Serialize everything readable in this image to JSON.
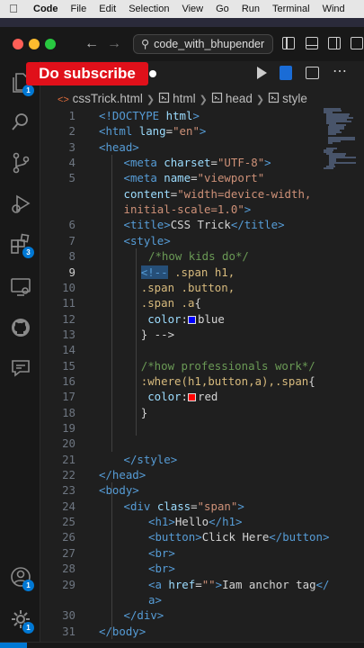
{
  "menubar": {
    "apple": "",
    "app_name": "Code",
    "items": [
      "File",
      "Edit",
      "Selection",
      "View",
      "Go",
      "Run",
      "Terminal",
      "Wind"
    ]
  },
  "titlebar": {
    "search_text": "code_with_bhupender",
    "back_icon": "arrow-left-icon",
    "forward_icon": "arrow-right-icon",
    "search_icon": "search-icon"
  },
  "overlay": {
    "subscribe_text": "Do subscribe"
  },
  "activity_bar": {
    "items": [
      {
        "name": "explorer",
        "icon": "files-icon",
        "badge": "1"
      },
      {
        "name": "search",
        "icon": "search-icon"
      },
      {
        "name": "source-control",
        "icon": "source-control-icon"
      },
      {
        "name": "run-debug",
        "icon": "run-debug-icon"
      },
      {
        "name": "extensions",
        "icon": "extensions-icon",
        "badge": "3"
      },
      {
        "name": "remote-explorer",
        "icon": "remote-explorer-icon"
      },
      {
        "name": "github",
        "icon": "github-icon"
      },
      {
        "name": "chat",
        "icon": "chat-icon"
      }
    ],
    "bottom": [
      {
        "name": "accounts",
        "icon": "account-icon",
        "badge": "1"
      },
      {
        "name": "manage",
        "icon": "gear-icon",
        "badge": "1"
      }
    ]
  },
  "breadcrumb": {
    "file": "cssTrick.html",
    "items": [
      "html",
      "head",
      "style"
    ]
  },
  "colors": {
    "accent": "#0078d4",
    "subscribe_red": "#e0101a",
    "swatch_blue": "#0000ff",
    "swatch_red": "#ff0000"
  },
  "editor": {
    "current_line": "9",
    "lines": [
      {
        "n": "1",
        "indent": 0,
        "t": [
          [
            "tag",
            "<!DOCTYPE "
          ],
          [
            "att",
            "html"
          ],
          [
            "tag",
            ">"
          ]
        ]
      },
      {
        "n": "2",
        "indent": 0,
        "t": [
          [
            "tag",
            "<html "
          ],
          [
            "att",
            "lang"
          ],
          [
            "txt",
            "="
          ],
          [
            "str",
            "\"en\""
          ],
          [
            "tag",
            ">"
          ]
        ]
      },
      {
        "n": "3",
        "indent": 0,
        "t": [
          [
            "tag",
            "<head>"
          ]
        ]
      },
      {
        "n": "4",
        "indent": 1,
        "t": [
          [
            "tag",
            "<meta "
          ],
          [
            "att",
            "charset"
          ],
          [
            "txt",
            "="
          ],
          [
            "str",
            "\"UTF-8\""
          ],
          [
            "tag",
            ">"
          ]
        ]
      },
      {
        "n": "5",
        "indent": 1,
        "t": [
          [
            "tag",
            "<meta "
          ],
          [
            "att",
            "name"
          ],
          [
            "txt",
            "="
          ],
          [
            "str",
            "\"viewport\""
          ]
        ]
      },
      {
        "n": "",
        "indent": 1,
        "t": [
          [
            "att",
            "content"
          ],
          [
            "txt",
            "="
          ],
          [
            "str",
            "\"width=device-width,"
          ]
        ]
      },
      {
        "n": "",
        "indent": 1,
        "t": [
          [
            "str",
            "initial-scale=1.0\""
          ],
          [
            "tag",
            ">"
          ]
        ]
      },
      {
        "n": "6",
        "indent": 1,
        "t": [
          [
            "tag",
            "<title>"
          ],
          [
            "txt",
            "CSS Trick"
          ],
          [
            "tag",
            "</title>"
          ]
        ]
      },
      {
        "n": "7",
        "indent": 1,
        "t": [
          [
            "tag",
            "<style>"
          ]
        ]
      },
      {
        "n": "8",
        "indent": 2,
        "t": [
          [
            "cmt",
            "/*how kids do*/"
          ]
        ]
      },
      {
        "n": "9",
        "indent": 1.7,
        "t": [
          [
            "hl",
            "<!--"
          ],
          [
            "txt",
            " "
          ],
          [
            "sel",
            ".span h1,"
          ]
        ]
      },
      {
        "n": "10",
        "indent": 1.7,
        "t": [
          [
            "sel",
            ".span .button,"
          ]
        ]
      },
      {
        "n": "11",
        "indent": 1.7,
        "t": [
          [
            "sel",
            ".span .a"
          ],
          [
            "txt",
            "{"
          ]
        ]
      },
      {
        "n": "12",
        "indent": 1.7,
        "t": [
          [
            "txt",
            " "
          ],
          [
            "att",
            "color"
          ],
          [
            "txt",
            ":"
          ],
          [
            "swatch-blue",
            ""
          ],
          [
            "txt",
            "blue"
          ]
        ]
      },
      {
        "n": "13",
        "indent": 1.7,
        "t": [
          [
            "txt",
            "} "
          ],
          [
            "txt",
            "-->"
          ]
        ]
      },
      {
        "n": "14",
        "indent": 0,
        "t": []
      },
      {
        "n": "15",
        "indent": 1.7,
        "t": [
          [
            "cmt",
            "/*how professionals work*/"
          ]
        ]
      },
      {
        "n": "16",
        "indent": 1.7,
        "t": [
          [
            "sel",
            ":where(h1,button,a),.span"
          ],
          [
            "txt",
            "{"
          ]
        ]
      },
      {
        "n": "17",
        "indent": 1.7,
        "t": [
          [
            "txt",
            " "
          ],
          [
            "att",
            "color"
          ],
          [
            "txt",
            ":"
          ],
          [
            "swatch-red",
            ""
          ],
          [
            "txt",
            "red"
          ]
        ]
      },
      {
        "n": "18",
        "indent": 1.7,
        "t": [
          [
            "txt",
            "}"
          ]
        ]
      },
      {
        "n": "19",
        "indent": 0,
        "t": []
      },
      {
        "n": "20",
        "indent": 0,
        "t": []
      },
      {
        "n": "21",
        "indent": 1,
        "t": [
          [
            "tag",
            "</style>"
          ]
        ]
      },
      {
        "n": "22",
        "indent": 0,
        "t": [
          [
            "tag",
            "</head>"
          ]
        ]
      },
      {
        "n": "23",
        "indent": 0,
        "t": [
          [
            "tag",
            "<body>"
          ]
        ]
      },
      {
        "n": "24",
        "indent": 1,
        "t": [
          [
            "tag",
            "<div "
          ],
          [
            "att",
            "class"
          ],
          [
            "txt",
            "="
          ],
          [
            "str",
            "\"span\""
          ],
          [
            "tag",
            ">"
          ]
        ]
      },
      {
        "n": "25",
        "indent": 2,
        "t": [
          [
            "tag",
            "<h1>"
          ],
          [
            "txt",
            "Hello"
          ],
          [
            "tag",
            "</h1>"
          ]
        ]
      },
      {
        "n": "26",
        "indent": 2,
        "t": [
          [
            "tag",
            "<button>"
          ],
          [
            "txt",
            "Click Here"
          ],
          [
            "tag",
            "</button>"
          ]
        ]
      },
      {
        "n": "27",
        "indent": 2,
        "t": [
          [
            "tag",
            "<br>"
          ]
        ]
      },
      {
        "n": "28",
        "indent": 2,
        "t": [
          [
            "tag",
            "<br>"
          ]
        ]
      },
      {
        "n": "29",
        "indent": 2,
        "t": [
          [
            "tag",
            "<a "
          ],
          [
            "att",
            "href"
          ],
          [
            "txt",
            "="
          ],
          [
            "str",
            "\"\""
          ],
          [
            "tag",
            ">"
          ],
          [
            "txt",
            "Iam anchor tag"
          ],
          [
            "tag",
            "</"
          ]
        ]
      },
      {
        "n": "",
        "indent": 2,
        "t": [
          [
            "tag",
            "a>"
          ]
        ]
      },
      {
        "n": "30",
        "indent": 1,
        "t": [
          [
            "tag",
            "</div>"
          ]
        ]
      },
      {
        "n": "31",
        "indent": 0,
        "t": [
          [
            "tag",
            "</body>"
          ]
        ]
      }
    ]
  }
}
